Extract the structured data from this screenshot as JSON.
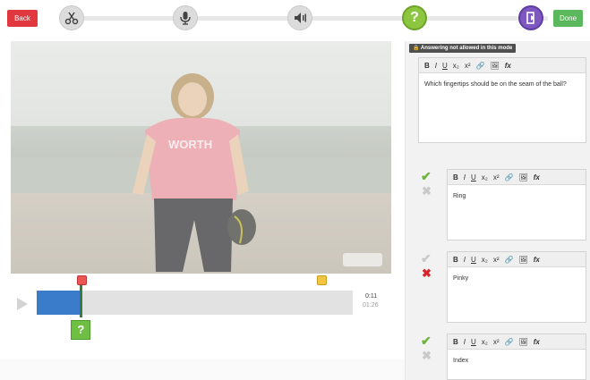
{
  "toolbar": {
    "back_label": "Back",
    "done_label": "Done",
    "tools": [
      {
        "icon": "scissors-icon"
      },
      {
        "icon": "microphone-icon"
      },
      {
        "icon": "speaker-icon"
      },
      {
        "icon": "question-icon",
        "glyph": "?"
      },
      {
        "icon": "exit-icon"
      }
    ]
  },
  "video": {
    "watermark": "YouTube"
  },
  "timeline": {
    "current_time": "0:11",
    "total_time": "01:26",
    "progress_fraction": 0.14,
    "question_badge": "?",
    "marker_labels": [
      "",
      ""
    ]
  },
  "panel": {
    "notice": "Answering not allowed in this mode",
    "question_text": "Which fingertips should be on the seam of the ball?",
    "toolbar_buttons": [
      "B",
      "I",
      "U",
      "x₂",
      "x²",
      "🔗",
      "🖼",
      "fx"
    ],
    "answers": [
      {
        "text": "Ring",
        "correct": true
      },
      {
        "text": "Pinky",
        "correct": false
      },
      {
        "text": "Index",
        "correct": true
      }
    ]
  },
  "colors": {
    "back": "#e0383e",
    "done": "#5cb85c",
    "progress": "#3a7cc9",
    "correct": "#6cb33f",
    "incorrect": "#d9242b"
  }
}
